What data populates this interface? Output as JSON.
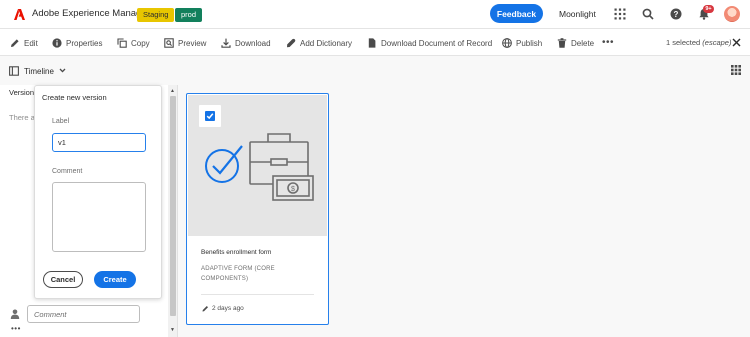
{
  "header": {
    "app_title": "Adobe Experience Manager",
    "env_staging": "Staging",
    "env_prod": "prod",
    "feedback_label": "Feedback",
    "org_name": "Moonlight",
    "notification_count": "9+"
  },
  "actions": [
    {
      "label": "Edit",
      "icon": "pencil-icon"
    },
    {
      "label": "Properties",
      "icon": "info-icon"
    },
    {
      "label": "Copy",
      "icon": "copy-icon"
    },
    {
      "label": "Preview",
      "icon": "preview-icon"
    },
    {
      "label": "Download",
      "icon": "download-icon"
    },
    {
      "label": "Add Dictionary",
      "icon": "dictionary-icon"
    },
    {
      "label": "Download Document of Record",
      "icon": "document-icon"
    },
    {
      "label": "Publish",
      "icon": "globe-icon"
    },
    {
      "label": "Delete",
      "icon": "trash-icon"
    }
  ],
  "selection": {
    "count_text": "1 selected",
    "hint": "(escape)"
  },
  "rail": {
    "view_label": "Timeline",
    "versions_label": "Version",
    "empty_text": "There a"
  },
  "create_version": {
    "title": "Create new version",
    "label_field_label": "Label",
    "label_value": "v1",
    "comment_field_label": "Comment",
    "comment_value": "",
    "cancel_label": "Cancel",
    "create_label": "Create"
  },
  "comment_box": {
    "placeholder": "Comment"
  },
  "card": {
    "title": "Benefits enrollment form",
    "type": "ADAPTIVE FORM (CORE COMPONENTS)",
    "modified": "2 days ago",
    "selected": true
  },
  "colors": {
    "accent": "#1473e6",
    "staging": "#e8c600",
    "prod": "#12805c",
    "selection_border": "#2680eb"
  }
}
